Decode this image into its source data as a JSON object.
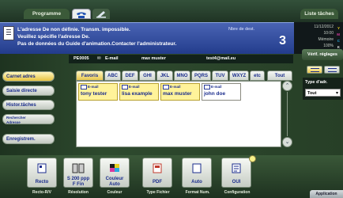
{
  "tabs": {
    "program_label": "Programme",
    "job_list_label": "Liste tâches"
  },
  "message": {
    "line1": "L'adresse De non définie. Transm. impossible.",
    "line2": "Veuillez spécifie l'adresse De.",
    "line3": "Pas de données du Guide d'animation.Contacter l'administrateur.",
    "dest_label": "Nbre de dest.",
    "dest_count": "3"
  },
  "status": {
    "date": "11/12/2012",
    "time": "10:00",
    "memory_label": "Mémoire",
    "memory_value": "100%",
    "toner": [
      "Y",
      "M",
      "C",
      "K"
    ],
    "toner_colors": [
      "#e8d020",
      "#d83aa0",
      "#2aa8e0",
      "#e0e0e0"
    ]
  },
  "verify_label": "Vérif. réglages",
  "sender": {
    "id": "PE0005",
    "type_label": "E-mail",
    "name": "max muster",
    "email": "test4@mail.eu"
  },
  "left_menu": [
    {
      "label": "Carnet adres"
    },
    {
      "label": "Saisie directe"
    },
    {
      "label": "Histor.tâches"
    },
    {
      "label": "Rechercher",
      "label2": "Adresse"
    },
    {
      "label": "Enregistrem."
    }
  ],
  "index_tabs": [
    "Favoris",
    "ABC",
    "DEF",
    "GHI",
    "JKL",
    "MNO",
    "PQRS",
    "TUV",
    "WXYZ",
    "etc",
    "Tout"
  ],
  "address_book": [
    {
      "type": "E-mail",
      "name": "tony tester",
      "selected": true
    },
    {
      "type": "E-mail",
      "name": "lisa example",
      "selected": true
    },
    {
      "type": "E-mail",
      "name": "max muster",
      "selected": true
    },
    {
      "type": "E-mail",
      "name": "john doe",
      "selected": false
    }
  ],
  "address_type": {
    "label": "Type d'adr.",
    "value": "Tout"
  },
  "functions": [
    {
      "value": "Recto",
      "label": "Recto-R/V"
    },
    {
      "value": "S 200 ppp",
      "value2": "F Fin",
      "label": "Résolution"
    },
    {
      "value": "Couleur",
      "value2": "Auto",
      "label": "Couleur"
    },
    {
      "value": "PDF",
      "label": "Type Fichier"
    },
    {
      "value": "Auto",
      "label": "Format Num."
    },
    {
      "value": "OUI",
      "label": "Configuration"
    }
  ],
  "application_label": "Application"
}
